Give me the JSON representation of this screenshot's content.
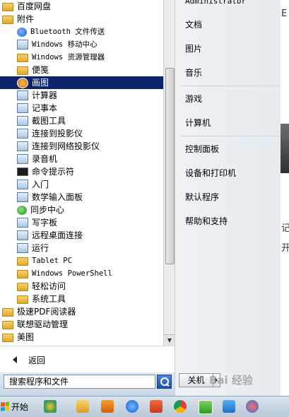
{
  "programs": [
    {
      "label": "百度网盘",
      "icon": "folder-icon",
      "mono": false
    },
    {
      "label": "附件",
      "icon": "folder-icon",
      "mono": false
    },
    {
      "label": "Bluetooth 文件传送",
      "icon": "bluetooth-icon",
      "mono": true
    },
    {
      "label": "Windows 移动中心",
      "icon": "mobility-center-icon",
      "mono": true
    },
    {
      "label": "Windows 资源管理器",
      "icon": "explorer-icon",
      "mono": true
    },
    {
      "label": "便笺",
      "icon": "sticky-notes-icon",
      "mono": false
    },
    {
      "label": "画图",
      "icon": "paint-icon",
      "mono": false,
      "selected": true
    },
    {
      "label": "计算器",
      "icon": "calculator-icon",
      "mono": false
    },
    {
      "label": "记事本",
      "icon": "notepad-icon",
      "mono": false
    },
    {
      "label": "截图工具",
      "icon": "snipping-tool-icon",
      "mono": false
    },
    {
      "label": "连接到投影仪",
      "icon": "projector-icon",
      "mono": false
    },
    {
      "label": "连接到网络投影仪",
      "icon": "network-projector-icon",
      "mono": false
    },
    {
      "label": "录音机",
      "icon": "sound-recorder-icon",
      "mono": false
    },
    {
      "label": "命令提示符",
      "icon": "command-prompt-icon",
      "mono": false
    },
    {
      "label": "入门",
      "icon": "getting-started-icon",
      "mono": false
    },
    {
      "label": "数学输入面板",
      "icon": "math-input-icon",
      "mono": false
    },
    {
      "label": "同步中心",
      "icon": "sync-center-icon",
      "mono": false
    },
    {
      "label": "写字板",
      "icon": "wordpad-icon",
      "mono": false
    },
    {
      "label": "远程桌面连接",
      "icon": "remote-desktop-icon",
      "mono": false
    },
    {
      "label": "运行",
      "icon": "run-icon",
      "mono": false
    },
    {
      "label": "Tablet PC",
      "icon": "folder-icon",
      "mono": true
    },
    {
      "label": "Windows PowerShell",
      "icon": "folder-icon",
      "mono": true
    },
    {
      "label": "轻松访问",
      "icon": "folder-icon",
      "mono": false
    },
    {
      "label": "系统工具",
      "icon": "folder-icon",
      "mono": false
    },
    {
      "label": "极速PDF阅读器",
      "icon": "folder-icon",
      "mono": false
    },
    {
      "label": "联想驱动管理",
      "icon": "folder-icon",
      "mono": false
    },
    {
      "label": "美图",
      "icon": "folder-icon",
      "mono": false
    }
  ],
  "back_label": "返回",
  "search": {
    "placeholder": "搜索程序和文件"
  },
  "right_pane": {
    "user": "Administrator",
    "items": [
      "文档",
      "图片",
      "音乐",
      "游戏",
      "计算机",
      "控制面板",
      "设备和打印机",
      "默认程序",
      "帮助和支持"
    ]
  },
  "shutdown_label": "关机",
  "watermark": "Bai 经验",
  "background_fragments": [
    "E",
    "记",
    "开"
  ],
  "taskbar": {
    "start_label": "开始",
    "pinned": [
      "multicolor-app-icon",
      "file-explorer-icon",
      "media-player-icon",
      "sync-icon",
      "chrome-icon",
      "ie-icon",
      "app-icon",
      "media-icon"
    ]
  }
}
